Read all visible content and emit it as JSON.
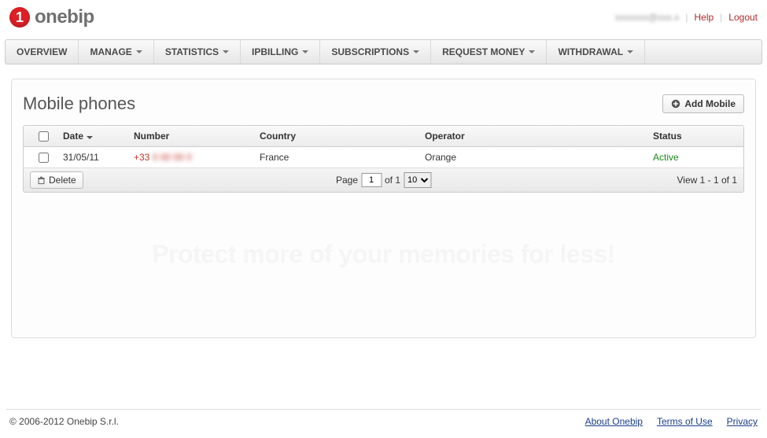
{
  "brand": {
    "name": "onebip",
    "glyph": "1"
  },
  "header": {
    "user_email": "xxxxxxx@xxx.x",
    "help": "Help",
    "logout": "Logout"
  },
  "nav": {
    "items": [
      {
        "label": "OVERVIEW",
        "dropdown": false
      },
      {
        "label": "MANAGE",
        "dropdown": true
      },
      {
        "label": "STATISTICS",
        "dropdown": true
      },
      {
        "label": "IPBILLING",
        "dropdown": true
      },
      {
        "label": "SUBSCRIPTIONS",
        "dropdown": true
      },
      {
        "label": "REQUEST MONEY",
        "dropdown": true
      },
      {
        "label": "WITHDRAWAL",
        "dropdown": true
      }
    ]
  },
  "page": {
    "title": "Mobile phones",
    "add_button": "Add Mobile"
  },
  "grid": {
    "columns": {
      "date": "Date",
      "number": "Number",
      "country": "Country",
      "operator": "Operator",
      "status": "Status"
    },
    "rows": [
      {
        "date": "31/05/11",
        "number_prefix": "+33",
        "number_rest": " 0 00 00 0",
        "country": "France",
        "operator": "Orange",
        "status": "Active"
      }
    ],
    "footer": {
      "delete": "Delete",
      "page_label": "Page",
      "page_value": "1",
      "of_label": "of 1",
      "per_page": "10",
      "view_text": "View 1 - 1 of 1"
    }
  },
  "watermark": "Protect more of your memories for less!",
  "footer": {
    "copyright": "© 2006-2012 Onebip S.r.l.",
    "links": {
      "about": "About Onebip",
      "terms": "Terms of Use",
      "privacy": "Privacy"
    }
  }
}
